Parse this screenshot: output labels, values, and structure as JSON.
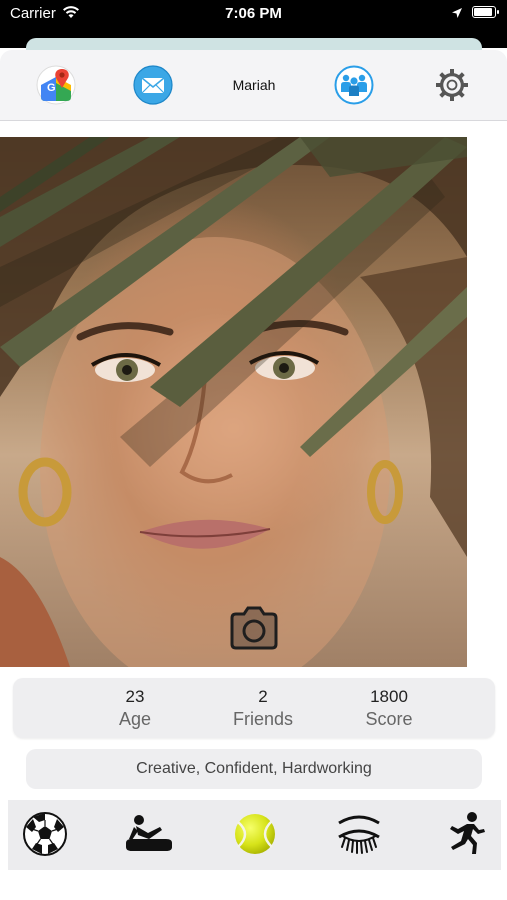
{
  "status_bar": {
    "carrier": "Carrier",
    "time": "7:06 PM"
  },
  "header": {
    "title": "Mariah",
    "icons": [
      "maps-icon",
      "mail-icon",
      "people-icon",
      "gear-icon"
    ]
  },
  "profile": {
    "photo_icon": "camera-icon",
    "stats": [
      {
        "value": "23",
        "label": "Age"
      },
      {
        "value": "2",
        "label": "Friends"
      },
      {
        "value": "1800",
        "label": "Score"
      }
    ],
    "traits": "Creative, Confident, Hardworking"
  },
  "bottom_bar": {
    "icons": [
      "soccer-ball-icon",
      "relax-icon",
      "tennis-ball-icon",
      "eyelash-icon",
      "running-icon"
    ]
  },
  "colors": {
    "accent_blue": "#2a9ee8",
    "card_background": "#eeeef0",
    "header_background": "#f4f4f6"
  }
}
